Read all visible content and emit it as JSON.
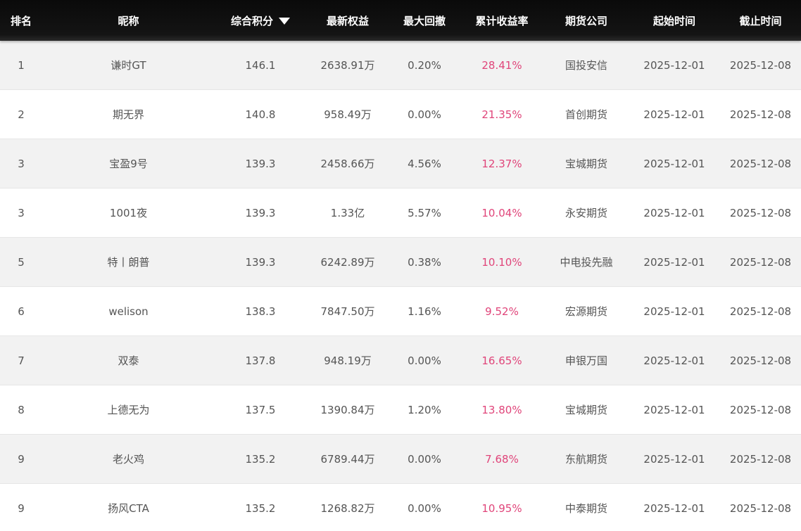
{
  "table": {
    "headers": {
      "rank": "排名",
      "nickname": "昵称",
      "score": "综合积分",
      "equity": "最新权益",
      "drawdown": "最大回撤",
      "return": "累计收益率",
      "company": "期货公司",
      "start": "起始时间",
      "end": "截止时间"
    },
    "sort_icon": "triangle-down-icon",
    "accent_color": "#e0457a",
    "rows": [
      {
        "rank": "1",
        "nickname": "谦时GT",
        "score": "146.1",
        "equity": "2638.91万",
        "drawdown": "0.20%",
        "return": "28.41%",
        "company": "国投安信",
        "start": "2025-12-01",
        "end": "2025-12-08"
      },
      {
        "rank": "2",
        "nickname": "期无界",
        "score": "140.8",
        "equity": "958.49万",
        "drawdown": "0.00%",
        "return": "21.35%",
        "company": "首创期货",
        "start": "2025-12-01",
        "end": "2025-12-08"
      },
      {
        "rank": "3",
        "nickname": "宝盈9号",
        "score": "139.3",
        "equity": "2458.66万",
        "drawdown": "4.56%",
        "return": "12.37%",
        "company": "宝城期货",
        "start": "2025-12-01",
        "end": "2025-12-08"
      },
      {
        "rank": "3",
        "nickname": "1001夜",
        "score": "139.3",
        "equity": "1.33亿",
        "drawdown": "5.57%",
        "return": "10.04%",
        "company": "永安期货",
        "start": "2025-12-01",
        "end": "2025-12-08"
      },
      {
        "rank": "5",
        "nickname": "特丨朗普",
        "score": "139.3",
        "equity": "6242.89万",
        "drawdown": "0.38%",
        "return": "10.10%",
        "company": "中电投先融",
        "start": "2025-12-01",
        "end": "2025-12-08"
      },
      {
        "rank": "6",
        "nickname": "welison",
        "score": "138.3",
        "equity": "7847.50万",
        "drawdown": "1.16%",
        "return": "9.52%",
        "company": "宏源期货",
        "start": "2025-12-01",
        "end": "2025-12-08"
      },
      {
        "rank": "7",
        "nickname": "双泰",
        "score": "137.8",
        "equity": "948.19万",
        "drawdown": "0.00%",
        "return": "16.65%",
        "company": "申银万国",
        "start": "2025-12-01",
        "end": "2025-12-08"
      },
      {
        "rank": "8",
        "nickname": "上德无为",
        "score": "137.5",
        "equity": "1390.84万",
        "drawdown": "1.20%",
        "return": "13.80%",
        "company": "宝城期货",
        "start": "2025-12-01",
        "end": "2025-12-08"
      },
      {
        "rank": "9",
        "nickname": "老火鸡",
        "score": "135.2",
        "equity": "6789.44万",
        "drawdown": "0.00%",
        "return": "7.68%",
        "company": "东航期货",
        "start": "2025-12-01",
        "end": "2025-12-08"
      },
      {
        "rank": "9",
        "nickname": "扬风CTA",
        "score": "135.2",
        "equity": "1268.82万",
        "drawdown": "0.00%",
        "return": "10.95%",
        "company": "中泰期货",
        "start": "2025-12-01",
        "end": "2025-12-08"
      }
    ]
  }
}
